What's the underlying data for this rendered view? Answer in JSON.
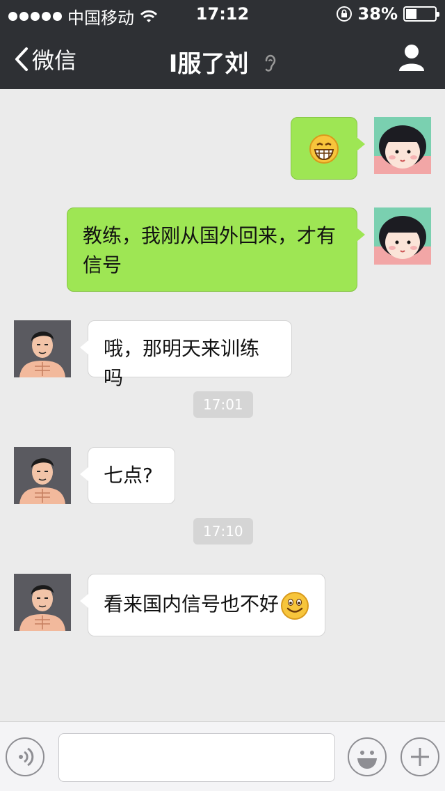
{
  "status_bar": {
    "carrier": "中国移动",
    "time": "17:12",
    "battery": "38%",
    "battery_level": 0.38,
    "icons": [
      "signal-dots-icon",
      "wifi-icon",
      "rotation-lock-icon",
      "battery-icon"
    ]
  },
  "nav": {
    "back_label": "微信",
    "title": "I服了刘",
    "icons": [
      "back-chevron-icon",
      "ear-icon",
      "profile-icon"
    ]
  },
  "messages": [
    {
      "id": 1,
      "direction": "out",
      "type": "emoji",
      "emoji_name": "grin-emoji"
    },
    {
      "id": 2,
      "direction": "out",
      "type": "text",
      "text_line1": "教练，我刚从国外回来，才有",
      "text_line2": "信号"
    },
    {
      "id": 3,
      "direction": "in",
      "type": "text",
      "text": "哦，那明天来训练吗"
    },
    {
      "id": 4,
      "type": "timestamp",
      "text": "17:01"
    },
    {
      "id": 5,
      "direction": "in",
      "type": "text",
      "text": "七点?"
    },
    {
      "id": 6,
      "type": "timestamp",
      "text": "17:10"
    },
    {
      "id": 7,
      "direction": "in",
      "type": "text",
      "text": "看来国内信号也不好",
      "emoji_name": "smile-emoji"
    }
  ],
  "input_bar": {
    "text_value": "",
    "icons": [
      "voice-icon",
      "emoji-face-icon",
      "plus-icon"
    ]
  },
  "colors": {
    "header_bg": "#2e3034",
    "chat_bg": "#ebebeb",
    "outgoing_bubble": "#9ee654",
    "incoming_bubble": "#ffffff",
    "timestamp_pill": "#d5d5d5"
  }
}
